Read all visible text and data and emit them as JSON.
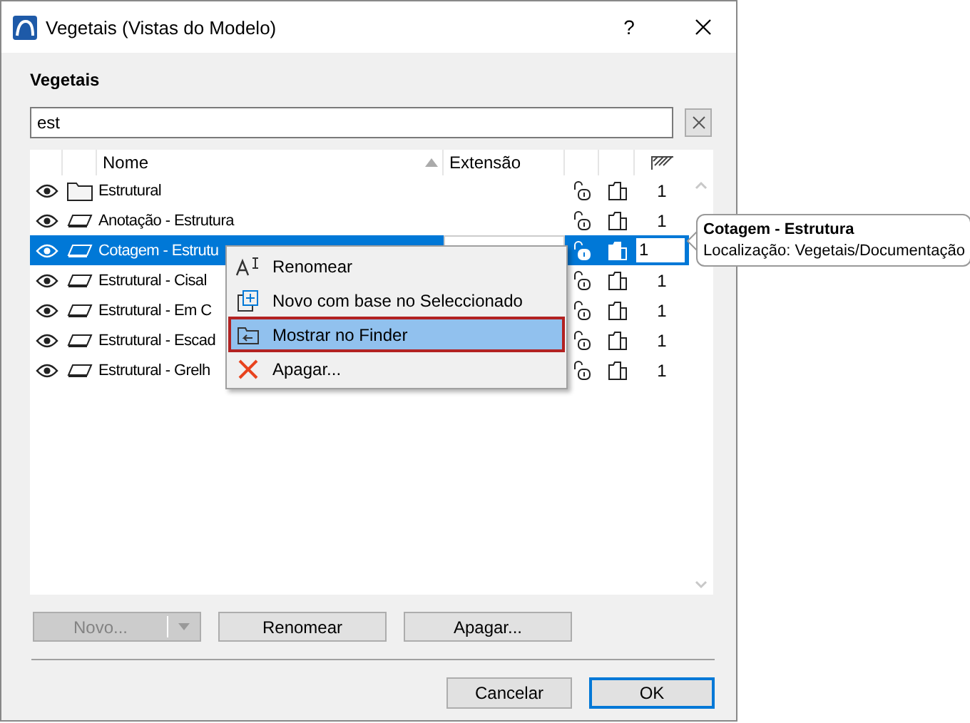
{
  "window": {
    "title": "Vegetais (Vistas do Modelo)",
    "help": "?"
  },
  "heading": "Vegetais",
  "search": {
    "value": "est"
  },
  "table": {
    "columns": [
      "Nome",
      "Extensão"
    ],
    "rows": [
      {
        "name": "Estrutural",
        "kind": "folder",
        "selected": false,
        "value": "1"
      },
      {
        "name": "Anotação - Estrutura",
        "kind": "layer",
        "selected": false,
        "value": "1"
      },
      {
        "name": "Cotagem - Estrutu",
        "kind": "layer",
        "selected": true,
        "value": "1"
      },
      {
        "name": "Estrutural - Cisal",
        "kind": "layer",
        "selected": false,
        "value": "1"
      },
      {
        "name": "Estrutural - Em C",
        "kind": "layer",
        "selected": false,
        "value": "1"
      },
      {
        "name": "Estrutural - Escad",
        "kind": "layer",
        "selected": false,
        "value": "1"
      },
      {
        "name": "Estrutural - Grelh",
        "kind": "layer",
        "selected": false,
        "value": "1"
      }
    ]
  },
  "context_menu": {
    "items": [
      {
        "label": "Renomear",
        "kind": "rename",
        "selected": false
      },
      {
        "label": "Novo com base no Seleccionado",
        "kind": "new",
        "selected": false
      },
      {
        "label": "Mostrar no Finder",
        "kind": "show",
        "selected": true
      },
      {
        "label": "Apagar...",
        "kind": "delete",
        "selected": false
      }
    ]
  },
  "tooltip": {
    "title": "Cotagem - Estrutura",
    "text": "Localização: Vegetais/Documentação"
  },
  "actions": [
    {
      "label": "Novo...",
      "kind": "split",
      "disabled": true
    },
    {
      "label": "Renomear",
      "kind": "plain",
      "disabled": false
    },
    {
      "label": "Apagar...",
      "kind": "plain",
      "disabled": false
    }
  ],
  "dialog_buttons": [
    {
      "label": "Cancelar",
      "default": false
    },
    {
      "label": "OK",
      "default": true
    }
  ]
}
